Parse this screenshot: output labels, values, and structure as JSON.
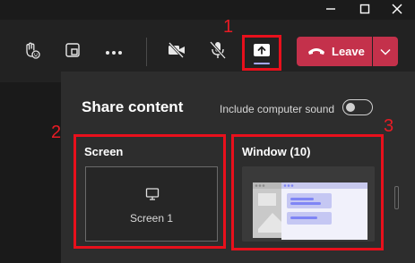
{
  "window_controls": {
    "minimize_icon": "minimize-icon",
    "maximize_icon": "maximize-icon",
    "close_icon": "close-icon"
  },
  "toolbar": {
    "leave_label": "Leave",
    "accent_color": "#a6a7ff",
    "leave_color": "#c4314b"
  },
  "callouts": {
    "one": "1",
    "two": "2",
    "three": "3"
  },
  "share_panel": {
    "title": "Share content",
    "include_sound_label": "Include computer sound",
    "include_sound_on": false,
    "screen_section": {
      "title": "Screen",
      "items": [
        {
          "label": "Screen 1"
        }
      ]
    },
    "window_section": {
      "title": "Window (10)"
    }
  }
}
